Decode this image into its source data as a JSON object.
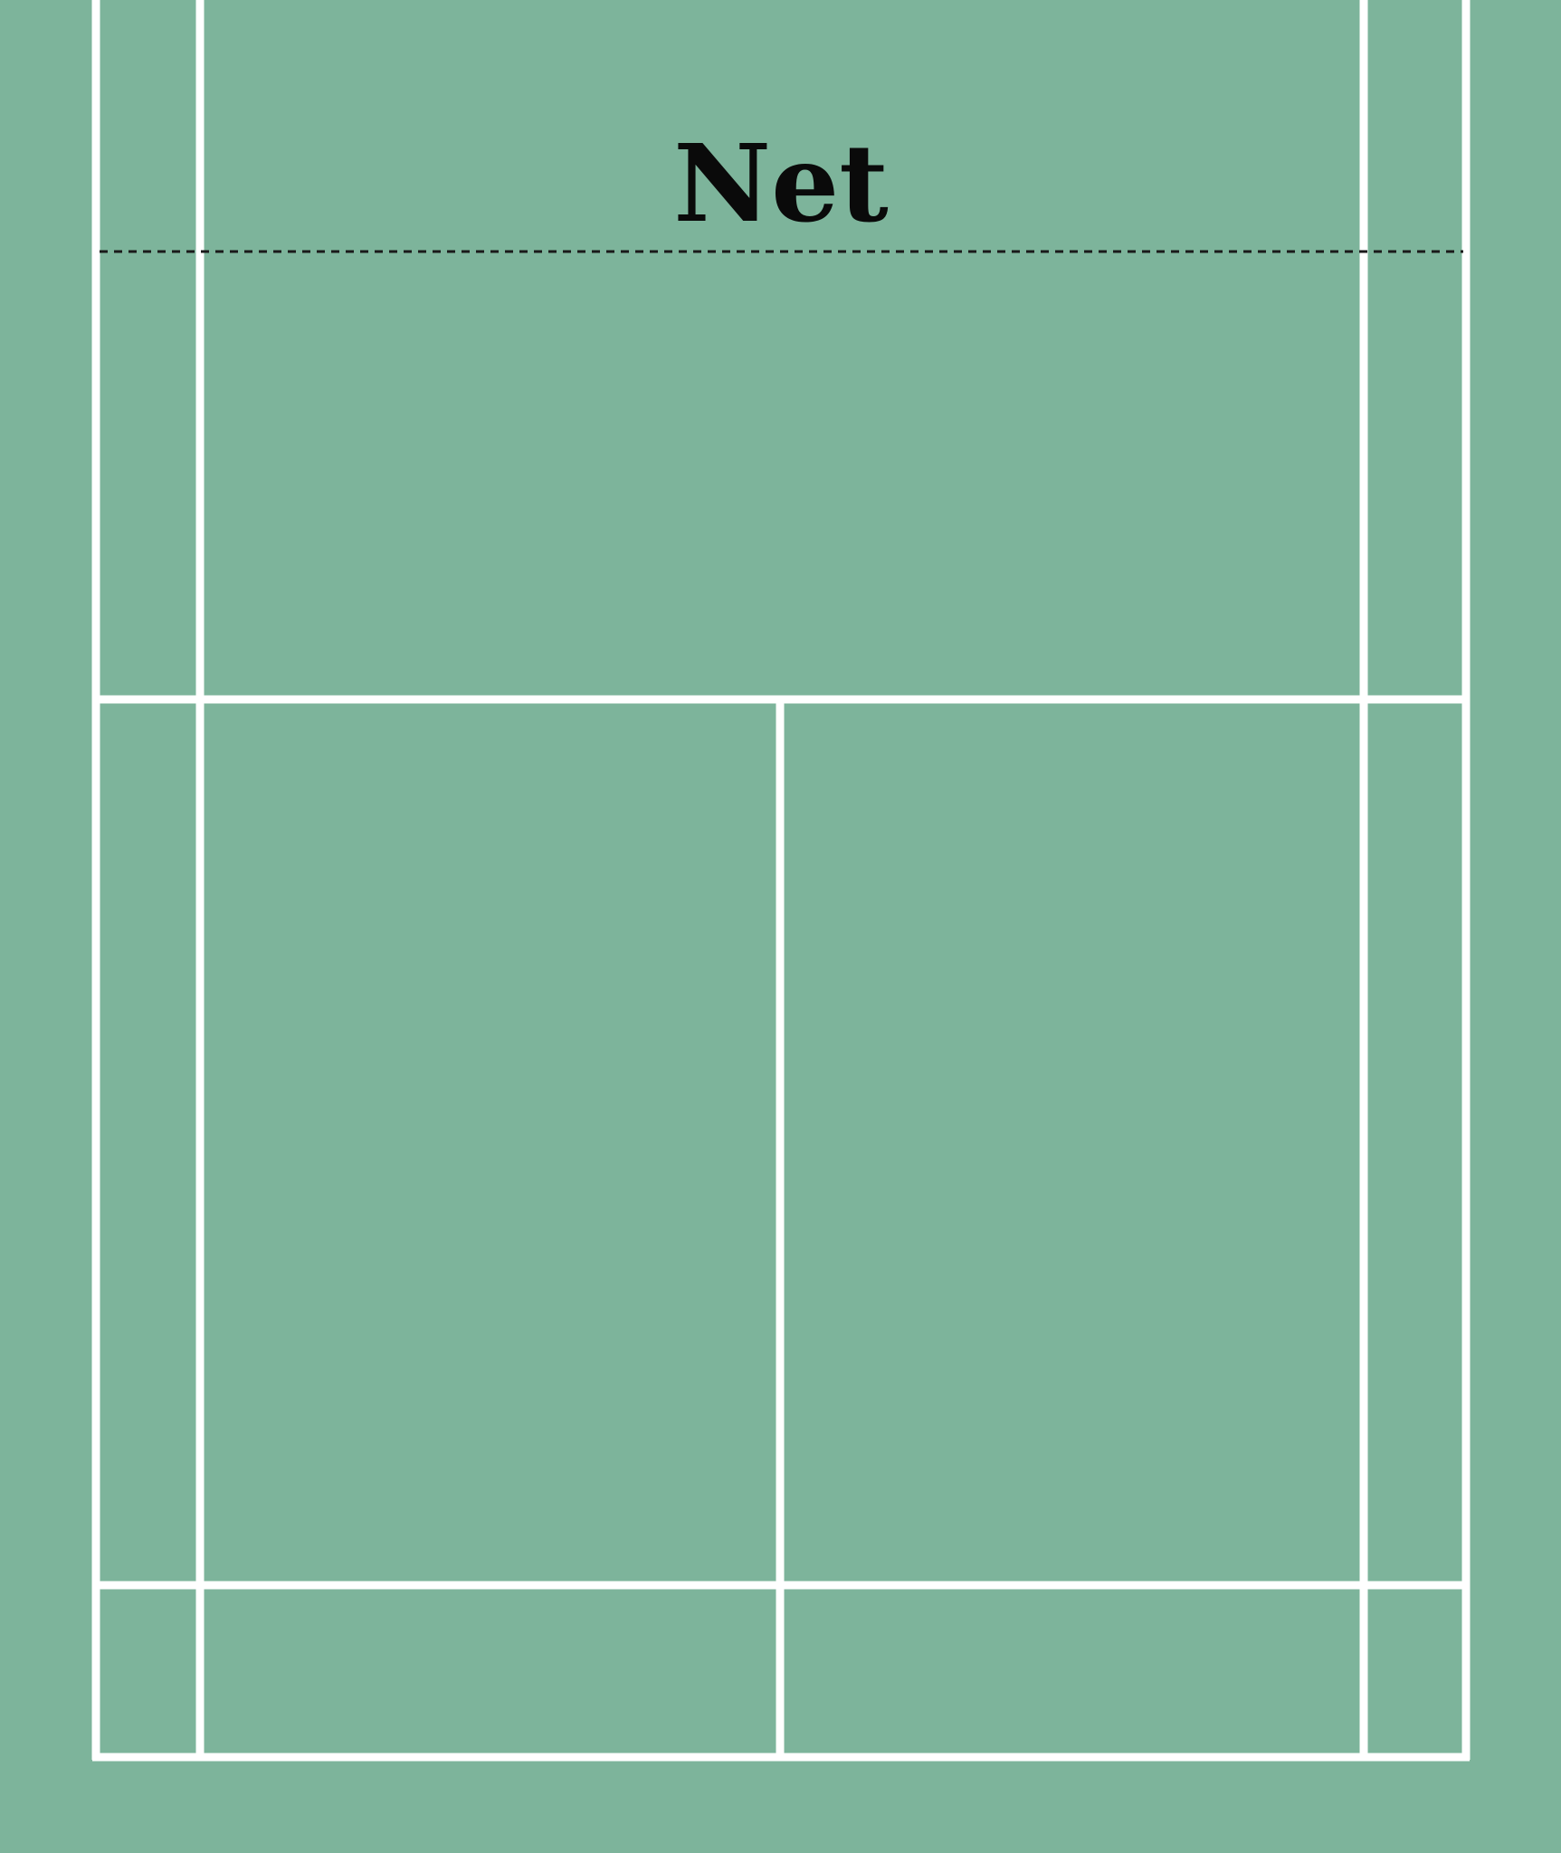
{
  "diagram": {
    "net_label": "Net"
  },
  "colors": {
    "surface": "#7db49b",
    "court_lines": "#ffffff",
    "net_line": "#1a1a1a",
    "label_text": "#0a0a0a"
  }
}
